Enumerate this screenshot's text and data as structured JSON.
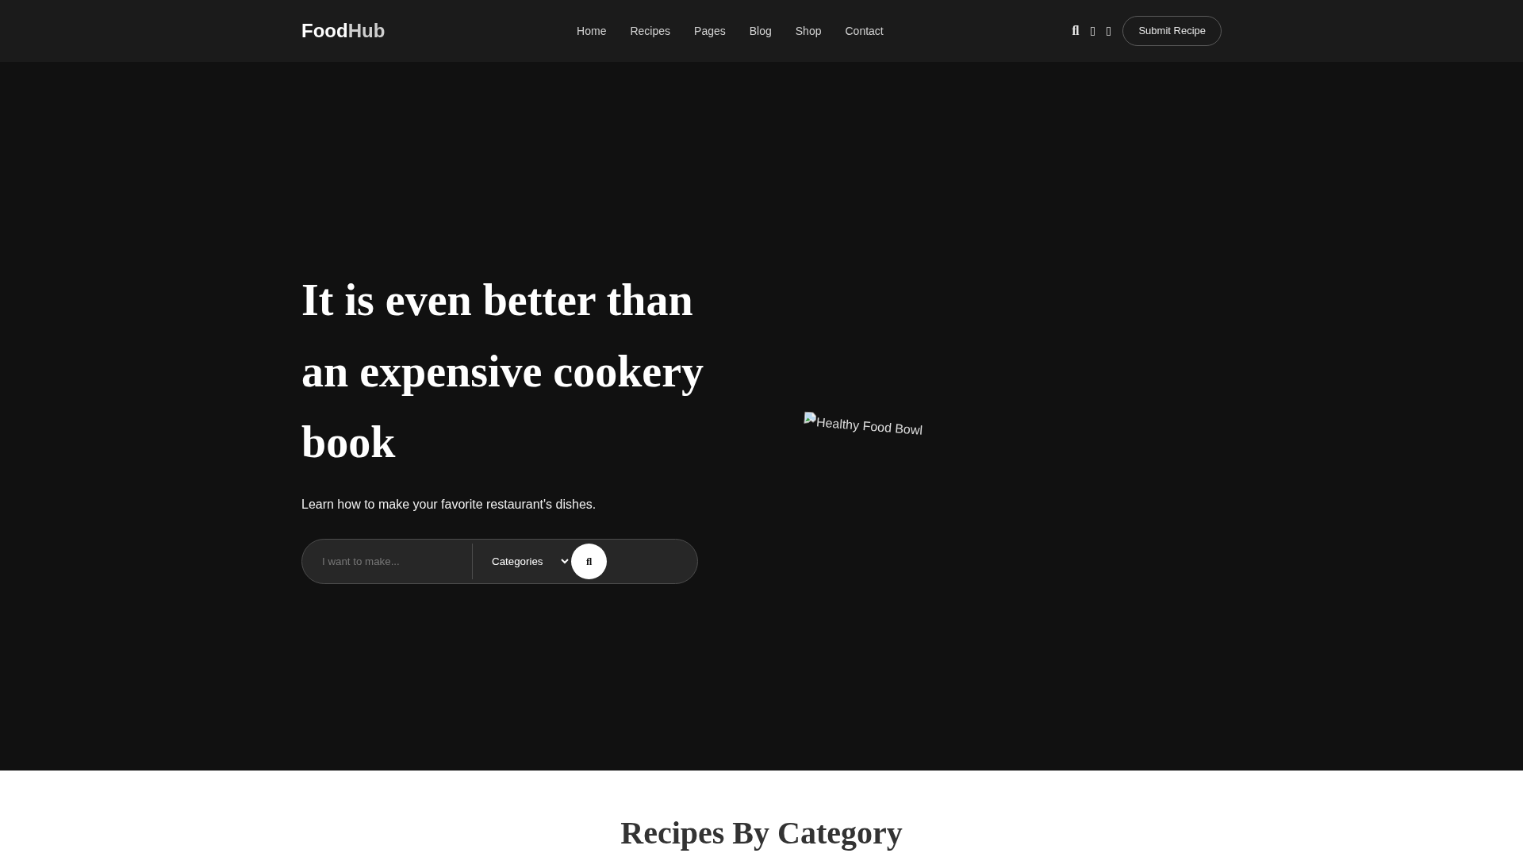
{
  "header": {
    "logo": {
      "first": "Food",
      "second": "Hub"
    },
    "nav": [
      "Home",
      "Recipes",
      "Pages",
      "Blog",
      "Shop",
      "Contact"
    ],
    "search_glyph": "ﬂ",
    "submit_button": "Submit Recipe"
  },
  "hero": {
    "title": "It is even better than an expensive cookery book",
    "subtitle": "Learn how to make your favorite restaurant's dishes.",
    "search": {
      "placeholder": "I want to make...",
      "category": "Categories",
      "button_glyph": "ﬂ"
    },
    "image": {
      "alt": "Healthy Food Bowl"
    }
  },
  "categories_section": {
    "heading": "Recipes By Category"
  }
}
